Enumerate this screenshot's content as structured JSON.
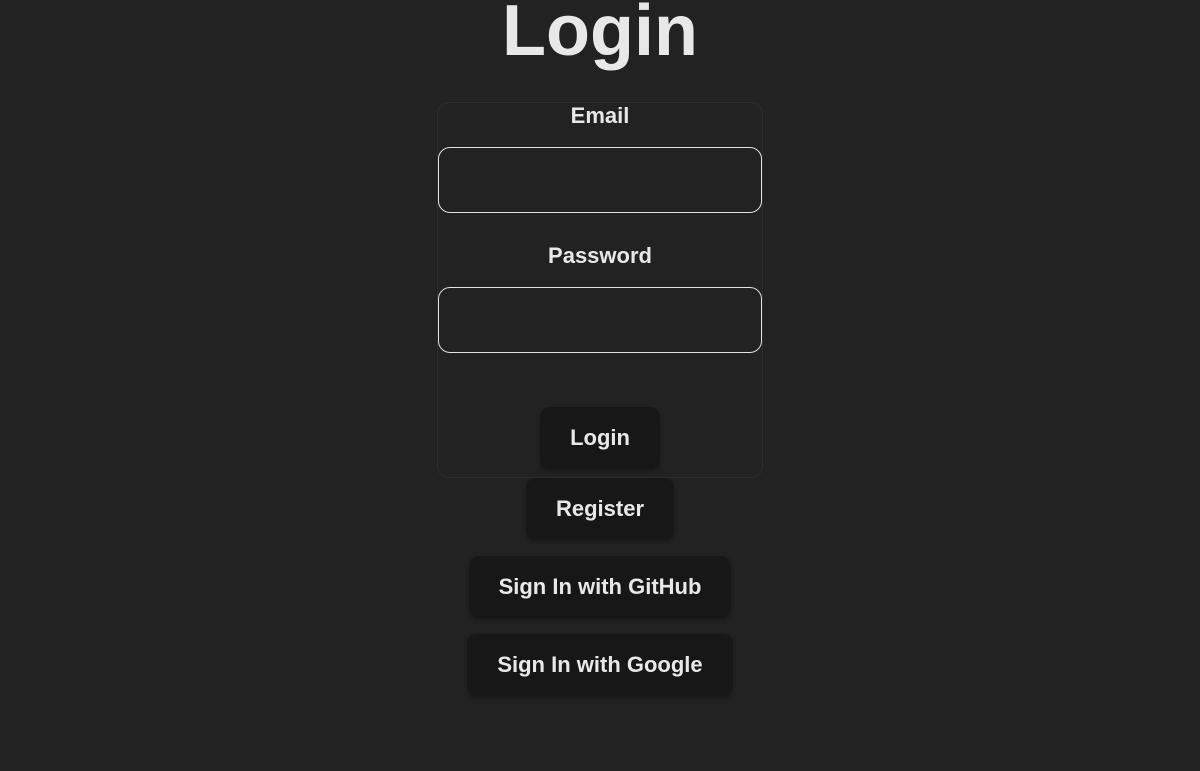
{
  "title": "Login",
  "form": {
    "email": {
      "label": "Email",
      "value": "",
      "placeholder": ""
    },
    "password": {
      "label": "Password",
      "value": "",
      "placeholder": ""
    }
  },
  "buttons": {
    "login": "Login",
    "register": "Register",
    "github": "Sign In with GitHub",
    "google": "Sign In with Google"
  }
}
